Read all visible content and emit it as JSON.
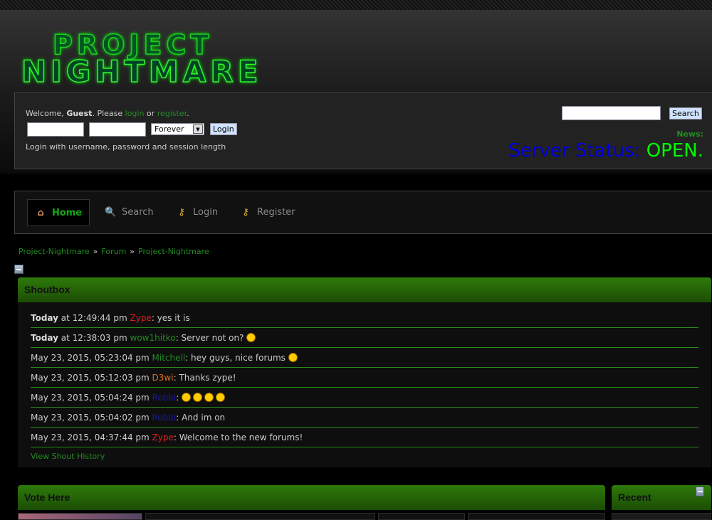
{
  "logo": {
    "line1": "PROJECT",
    "line2": "NIGHTMARE"
  },
  "login": {
    "welcome": "Welcome, ",
    "guest": "Guest",
    "please": ". Please ",
    "login_link": "login",
    "or": " or ",
    "register_link": "register",
    "dot": ".",
    "session": "Forever",
    "button": "Login",
    "hint": "Login with username, password and session length"
  },
  "search": {
    "button": "Search",
    "value": ""
  },
  "news": {
    "label": "News:",
    "status_label": "Server Status:",
    "status_value": "OPEN."
  },
  "nav": [
    {
      "label": "Home",
      "icon": "home-icon"
    },
    {
      "label": "Search",
      "icon": "search-icon"
    },
    {
      "label": "Login",
      "icon": "key-icon"
    },
    {
      "label": "Register",
      "icon": "key-add-icon"
    }
  ],
  "breadcrumb": [
    "Project-Nightmare",
    "Forum",
    "Project-Nightmare"
  ],
  "breadcrumb_sep": "»",
  "shoutbox": {
    "title": "Shoutbox",
    "history": "View Shout History",
    "shouts": [
      {
        "day": "Today",
        "time": " at 12:49:44 pm ",
        "user": "Zype",
        "color": "#e02020",
        "msg": ": yes it is",
        "emoji": 0
      },
      {
        "day": "Today",
        "time": " at 12:38:03 pm ",
        "user": "wow1hitko",
        "color": "#228b22",
        "msg": ": Server not on? ",
        "emoji": 1
      },
      {
        "day": "",
        "time": "May 23, 2015, 05:23:04 pm ",
        "user": "Mitchell",
        "color": "#228b22",
        "msg": ": hey guys, nice forums ",
        "emoji": 1
      },
      {
        "day": "",
        "time": "May 23, 2015, 05:12:03 pm ",
        "user": "D3wi",
        "color": "#e07020",
        "msg": ": Thanks zype!",
        "emoji": 0
      },
      {
        "day": "",
        "time": "May 23, 2015, 05:04:24 pm ",
        "user": "Robbi",
        "color": "#1a1a90",
        "msg": ": ",
        "emoji": 4
      },
      {
        "day": "",
        "time": "May 23, 2015, 05:04:02 pm ",
        "user": "Robbi",
        "color": "#1a1a90",
        "msg": ": And im on",
        "emoji": 0
      },
      {
        "day": "",
        "time": "May 23, 2015, 04:37:44 pm ",
        "user": "Zype",
        "color": "#e02020",
        "msg": ": Welcome to the new forums!",
        "emoji": 0
      }
    ]
  },
  "vote": {
    "title": "Vote Here"
  },
  "recent": {
    "title": "Recent"
  }
}
